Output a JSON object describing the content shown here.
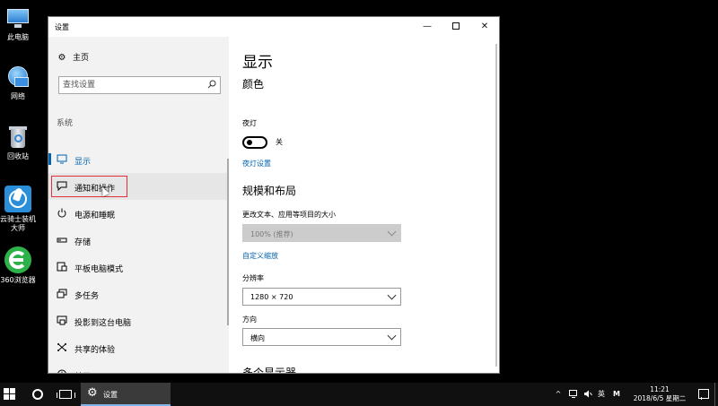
{
  "desktop": {
    "icons": [
      {
        "label": "此电脑",
        "icon": "computer-icon"
      },
      {
        "label": "网络",
        "icon": "network-icon"
      },
      {
        "label": "回收站",
        "icon": "recycle-bin-icon"
      },
      {
        "label": "云骑士装机大师",
        "icon": "knight-installer-icon"
      },
      {
        "label": "360浏览器",
        "icon": "360-browser-icon"
      }
    ]
  },
  "window": {
    "title": "设置",
    "controls": {
      "minimize": "—",
      "close": "✕"
    }
  },
  "sidebar": {
    "home_label": "主页",
    "search_placeholder": "查找设置",
    "section_label": "系统",
    "items": [
      {
        "label": "显示",
        "icon": "monitor-icon"
      },
      {
        "label": "通知和操作",
        "icon": "message-icon"
      },
      {
        "label": "电源和睡眠",
        "icon": "power-icon"
      },
      {
        "label": "存储",
        "icon": "storage-icon"
      },
      {
        "label": "平板电脑模式",
        "icon": "tablet-icon"
      },
      {
        "label": "多任务",
        "icon": "multitask-icon"
      },
      {
        "label": "投影到这台电脑",
        "icon": "project-icon"
      },
      {
        "label": "共享的体验",
        "icon": "share-icon"
      },
      {
        "label": "关于",
        "icon": "info-icon"
      }
    ]
  },
  "content": {
    "page_title": "显示",
    "color_heading": "颜色",
    "night_light_label": "夜灯",
    "night_light_state": "关",
    "night_light_settings_link": "夜灯设置",
    "scale_heading": "规模和布局",
    "scale_label": "更改文本、应用等项目的大小",
    "scale_value": "100% (推荐)",
    "custom_scale_link": "自定义缩放",
    "resolution_label": "分辨率",
    "resolution_value": "1280 × 720",
    "orientation_label": "方向",
    "orientation_value": "横向",
    "multi_display_heading": "多个显示器"
  },
  "taskbar": {
    "active_app": "设置",
    "tray": {
      "expand": "^",
      "ime": "英",
      "m_icon": "M"
    },
    "time": "11:21",
    "date": "2018/6/5 星期二"
  },
  "colors": {
    "accent": "#0063b1",
    "highlight_border": "#e0303a",
    "sidebar_bg": "#f2f2f2",
    "taskbar_bg": "#101010"
  }
}
